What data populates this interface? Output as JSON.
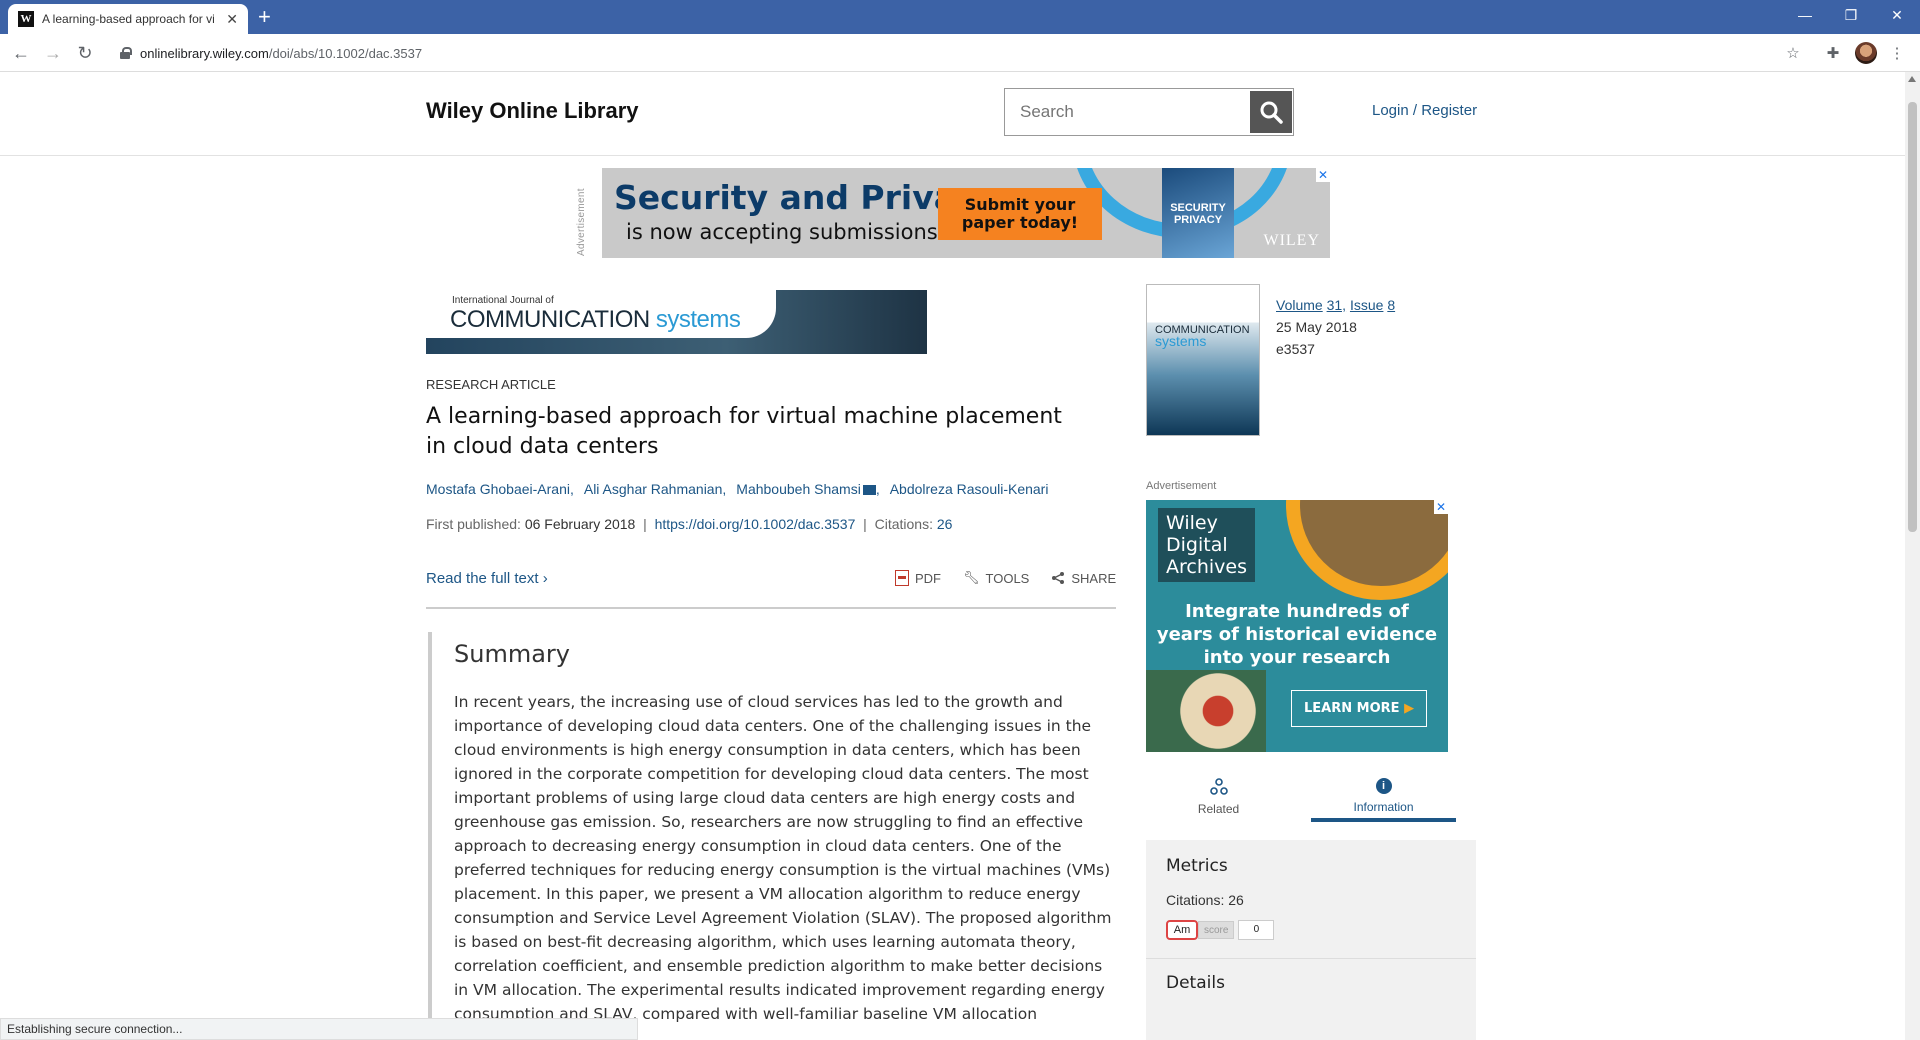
{
  "browser": {
    "tab_title": "A learning-based approach for vi",
    "favicon_letter": "W",
    "url_domain": "onlinelibrary.wiley.com",
    "url_path": "/doi/abs/10.1002/dac.3537",
    "status": "Establishing secure connection..."
  },
  "header": {
    "logo": "Wiley Online Library",
    "search_placeholder": "Search",
    "login": "Login / Register"
  },
  "top_ad": {
    "label": "Advertisement",
    "title": "Security and Privacy",
    "subtitle": "is now accepting submissions",
    "cta_line1": "Submit your",
    "cta_line2": "paper today!",
    "cover_text": "SECURITY PRIVACY",
    "brand": "WILEY"
  },
  "journal": {
    "small": "International Journal of",
    "name_main": "COMMUNICATION",
    "name_accent": "systems"
  },
  "article": {
    "type": "RESEARCH ARTICLE",
    "title": "A learning-based approach for virtual machine placement in cloud data centers",
    "authors": [
      "Mostafa Ghobaei-Arani,",
      "Ali Asghar Rahmanian,",
      "Mahboubeh Shamsi",
      "Abdolreza Rasouli-Kenari"
    ],
    "first_published_label": "First published:",
    "first_published": "06 February 2018",
    "doi": "https://doi.org/10.1002/dac.3537",
    "citations_label": "Citations:",
    "citations": "26",
    "read_full": "Read the full text",
    "actions": {
      "pdf": "PDF",
      "tools": "TOOLS",
      "share": "SHARE"
    }
  },
  "summary": {
    "heading": "Summary",
    "text": "In recent years, the increasing use of cloud services has led to the growth and importance of developing cloud data centers. One of the challenging issues in the cloud environments is high energy consumption in data centers, which has been ignored in the corporate competition for developing cloud data centers. The most important problems of using large cloud data centers are high energy costs and greenhouse gas emission. So, researchers are now struggling to find an effective approach to decreasing energy consumption in cloud data centers. One of the preferred techniques for reducing energy consumption is the virtual machines (VMs) placement. In this paper, we present a VM allocation algorithm to reduce energy consumption and Service Level Agreement Violation (SLAV). The proposed algorithm is based on best-fit decreasing algorithm, which uses learning automata theory, correlation coefficient, and ensemble prediction algorithm to make better decisions in VM allocation. The experimental results indicated improvement regarding energy consumption and SLAV, compared with well-familiar baseline VM allocation algorithms."
  },
  "issue": {
    "volume": "Volume",
    "volume_num": "31,",
    "issue": "Issue",
    "issue_num": "8",
    "date": "25 May 2018",
    "article_id": "e3537"
  },
  "side_ad": {
    "label": "Advertisement",
    "brand_l1": "Wiley",
    "brand_l2": "Digital",
    "brand_l3": "Archives",
    "text": "Integrate hundreds of years of historical evidence into your research",
    "button": "LEARN MORE"
  },
  "side_tabs": {
    "related": "Related",
    "information": "Information"
  },
  "metrics": {
    "heading": "Metrics",
    "citations_label": "Citations:",
    "citations": "26",
    "altmetric_am": "Am",
    "altmetric_score": "score",
    "altmetric_value": "0",
    "details": "Details"
  }
}
